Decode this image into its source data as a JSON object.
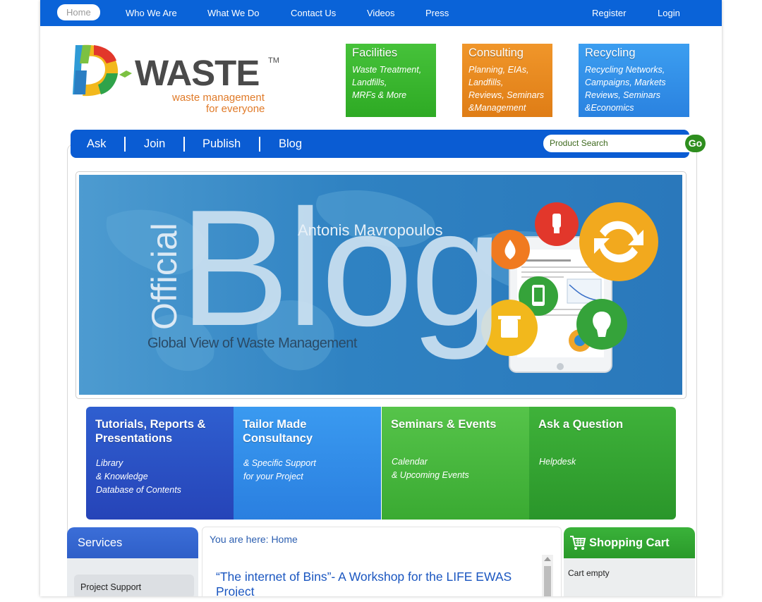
{
  "topnav": {
    "items": [
      "Home",
      "Who We Are",
      "What We Do",
      "Contact Us",
      "Videos",
      "Press"
    ],
    "right": [
      "Register",
      "Login"
    ]
  },
  "logo": {
    "letter": "D",
    "name": "WASTE",
    "tm": "TM",
    "tagline1": "waste management",
    "tagline2": "for everyone"
  },
  "categories": [
    {
      "title": "Facilities",
      "lines": [
        "Waste Treatment,",
        "Landfills,",
        "MRFs & More"
      ],
      "color": "#3db82f"
    },
    {
      "title": "Consulting",
      "lines": [
        "Planning, EIAs,",
        "Landfills,",
        "Reviews, Seminars",
        "&Management"
      ],
      "color": "#e88a1e"
    },
    {
      "title": "Recycling",
      "lines": [
        "Recycling Networks,",
        "Campaigns, Markets",
        "Reviews, Seminars",
        "&Economics"
      ],
      "color": "#2f8ee8"
    }
  ],
  "mainnav": {
    "items": [
      "Ask",
      "Join",
      "Publish",
      "Blog"
    ],
    "search_placeholder": "Product Search",
    "go": "Go"
  },
  "banner": {
    "official": "Official",
    "big": "Blog",
    "author": "Antonis Mavropoulos",
    "subtitle": "Global View of Waste Management"
  },
  "tiles": [
    {
      "title1": "Tutorials, Reports &",
      "title2": "Presentations",
      "lines": [
        "Library",
        "& Knowledge",
        "Database of Contents"
      ]
    },
    {
      "title1": "Tailor Made",
      "title2": "Consultancy",
      "lines": [
        "& Specific Support",
        "for your Project"
      ]
    },
    {
      "title1": "Seminars & Events",
      "title2": "",
      "lines": [
        "Calendar",
        "& Upcoming Events"
      ]
    },
    {
      "title1": "Ask a Question",
      "title2": "",
      "lines": [
        "Helpdesk"
      ]
    }
  ],
  "services": {
    "title": "Services",
    "items": [
      "Project Support"
    ]
  },
  "content": {
    "breadcrumb": "You are here: Home",
    "article_title": "“The internet of Bins”- A Workshop for the LIFE EWAS Project"
  },
  "cart": {
    "title": "Shopping Cart",
    "status": "Cart empty"
  },
  "colors": {
    "nav_blue": "#0a63d8",
    "accent_orange": "#e07a28",
    "green": "#3db82f"
  }
}
